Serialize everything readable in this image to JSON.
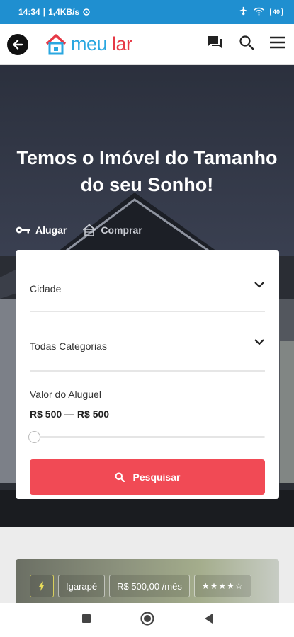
{
  "status": {
    "time": "14:34",
    "speed": "1,4KB/s",
    "battery": "40"
  },
  "header": {
    "logo_part1": "meu",
    "logo_part2": "lar"
  },
  "hero": {
    "title_line1": "Temos o Imóvel do Tamanho",
    "title_line2": "do seu Sonho!",
    "tabs": [
      {
        "label": "Alugar"
      },
      {
        "label": "Comprar"
      }
    ]
  },
  "search": {
    "city_label": "Cidade",
    "category_label": "Todas Categorias",
    "price_label": "Valor do Aluguel",
    "price_range": "R$ 500 — R$ 500",
    "button_label": "Pesquisar"
  },
  "listing": {
    "location": "Igarapé",
    "price": "R$ 500,00 /mês",
    "stars": "★★★★☆"
  },
  "colors": {
    "brand_blue": "#2aa7e0",
    "brand_red": "#e63946",
    "accent": "#f14a55",
    "statusbar": "#1f8fd0"
  }
}
